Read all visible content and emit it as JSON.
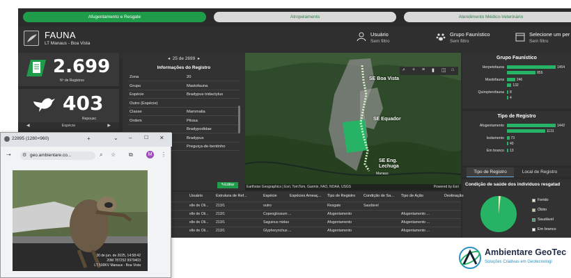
{
  "top_tabs": [
    "Afugentamento e Resgate",
    "Atropelamento",
    "Atendimento Médico-Veterinário"
  ],
  "header": {
    "title": "FAUNA",
    "subtitle": "LT Manaus - Boa Vista",
    "filters": [
      {
        "label": "Usuário",
        "value": "Sem filtro",
        "icon": "user-icon"
      },
      {
        "label": "Grupo Faunístico",
        "value": "Sem filtro",
        "icon": "paw-icon"
      },
      {
        "label": "Selecione um per",
        "value": "Sem filtro",
        "icon": "calendar-icon"
      }
    ]
  },
  "kpi": {
    "registros_value": "2.699",
    "registros_label": "Nº de Registros",
    "especies_value": "403",
    "especies_label": "Repouso",
    "especie_nav_label": "Espécie"
  },
  "record": {
    "pager": "25 de 2699",
    "title": "Informações do Registro",
    "fields": [
      {
        "k": "Zona",
        "v": "20"
      },
      {
        "k": "Grupo",
        "v": "Mastofauna"
      },
      {
        "k": "Espécie",
        "v": "Bradypus tridactylus"
      },
      {
        "k": "Outro (Espécie)",
        "v": ""
      },
      {
        "k": "Classe",
        "v": "Mammalia"
      },
      {
        "k": "Ordem",
        "v": "Pilosa"
      },
      {
        "k": "",
        "v": "Bradypodidae"
      },
      {
        "k": "",
        "v": "Bradypus"
      },
      {
        "k": "",
        "v": "Preguiça-de-bentinho"
      }
    ],
    "edit_label": "Editar"
  },
  "map": {
    "labels": [
      "SE Boa Vista",
      "SE Equador",
      "SE Eng. Lechuga",
      "Manaus"
    ],
    "attribution": "Earthstar Geographics | Esri, TomTom, Garmin, FAO, NOAA, USGS",
    "powered": "Powered by Esri"
  },
  "grupo_panel": {
    "title": "Grupo Faunístico",
    "rows": [
      {
        "label": "Herpetofauna",
        "values": [
          1454,
          855
        ]
      },
      {
        "label": "Mastofauna",
        "values": [
          246,
          132
        ]
      },
      {
        "label": "Quiropterofauna",
        "values": [
          8,
          4
        ]
      }
    ]
  },
  "tipo_panel": {
    "title": "Tipo de Registro",
    "rows": [
      {
        "label": "Afugentamento",
        "values": [
          1442,
          1131
        ]
      },
      {
        "label": "Isolamento",
        "values": [
          73,
          40
        ]
      },
      {
        "label": "Em branco",
        "values": [
          13
        ]
      }
    ],
    "tabs": [
      "Tipo de Registro",
      "Local de Registro"
    ]
  },
  "saude_panel": {
    "title": "Condição de saúde dos indivíduos resgatad",
    "legend": [
      "Ferido",
      "Óbito",
      "Saudável",
      "Em branco"
    ],
    "colors": [
      "#e6edc0",
      "#b9d99a",
      "#27b366",
      "#ffffff"
    ]
  },
  "table": {
    "headers": [
      "Usuário",
      "Estrutura de Ref...",
      "Espécie",
      "Espécies Ameaç...",
      "Tipo de Registro",
      "Condição de Sa...",
      "Tipo de Ação",
      "Destinação"
    ],
    "rows": [
      [
        "elle de Oli...",
        "213/1",
        "outro",
        "",
        "Resgate",
        "Saudável",
        "",
        ""
      ],
      [
        "elle de Oli...",
        "213/1",
        "Copeoglossum ...",
        "",
        "Afugentamento",
        "",
        "Afugentamento ...",
        ""
      ],
      [
        "elle de Oli...",
        "213/1",
        "Saguinus midas",
        "",
        "Afugentamento",
        "",
        "Afugentamento ...",
        ""
      ],
      [
        "elle de Oli...",
        "213/1",
        "Glyphorynchus ...",
        "",
        "Afugentamento",
        "",
        "Afugentamento ...",
        ""
      ]
    ]
  },
  "browser": {
    "title": "22895 (1280×960)",
    "url": "geo.ambientare.co...",
    "avatar_letter": "M",
    "stamp": [
      "30 de jun. de 2025, 14:58:42",
      "20M 787252 9979403",
      "LT 500KV Manaus - Boa Vista"
    ]
  },
  "brand": {
    "name": "Ambientare GeoTec",
    "tagline": "Soluções Criativas em Geotecnologi"
  }
}
